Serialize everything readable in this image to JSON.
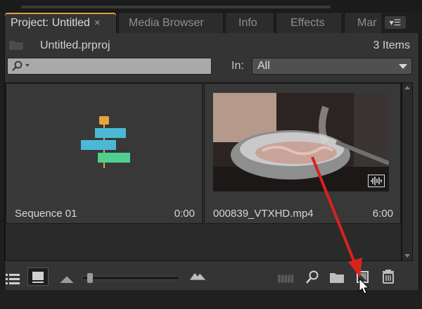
{
  "tabs": [
    {
      "label": "Project: Untitled",
      "active": true,
      "closable": true
    },
    {
      "label": "Media Browser"
    },
    {
      "label": "Info"
    },
    {
      "label": "Effects"
    },
    {
      "label": "Mar"
    }
  ],
  "panel_menu_icon": "panel-menu-icon",
  "project": {
    "name": "Untitled.prproj",
    "item_count": "3 Items"
  },
  "search": {
    "value": ""
  },
  "filter": {
    "label": "In:",
    "value": "All"
  },
  "bins": [
    {
      "name": "Sequence 01",
      "duration": "0:00",
      "icon": "sequence-icon"
    },
    {
      "name": "000839_VTXHD.mp4",
      "duration": "6:00",
      "icon": "video-thumbnail"
    }
  ],
  "toolbar": {
    "zoom_level": 0.05
  },
  "colors": {
    "accent": "#e0a53a",
    "annotation_arrow": "#d8231c",
    "seq_orange": "#e8a33b",
    "seq_blue": "#4bb9d6",
    "seq_green": "#4fd08f"
  }
}
